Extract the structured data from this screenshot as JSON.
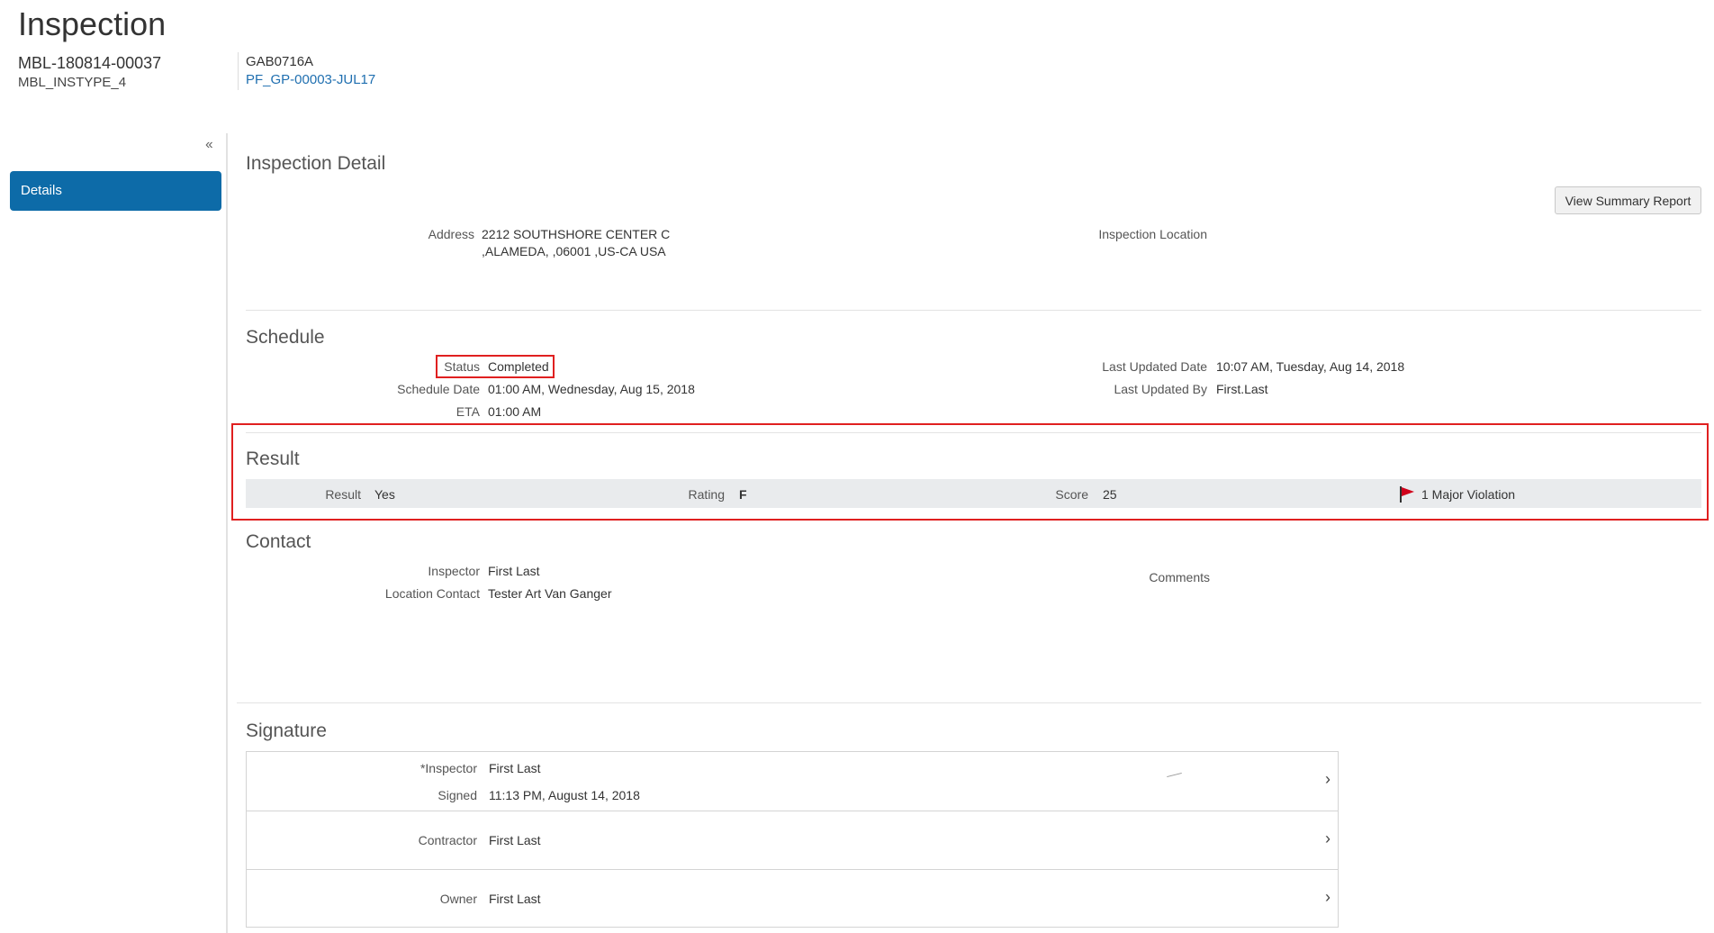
{
  "header": {
    "title": "Inspection",
    "record_id": "MBL-180814-00037",
    "record_type": "MBL_INSTYPE_4",
    "permit_code": "GAB0716A",
    "permit_link": "PF_GP-00003-JUL17"
  },
  "nav": {
    "collapse_glyph": "‹‹",
    "items": [
      {
        "label": "Details",
        "active": true
      }
    ]
  },
  "detail": {
    "title": "Inspection Detail",
    "summary_button": "View Summary Report",
    "address_label": "Address",
    "address_line1": "2212 SOUTHSHORE CENTER C",
    "address_line2": ",ALAMEDA, ,06001 ,US-CA USA",
    "location_label": "Inspection Location"
  },
  "schedule": {
    "title": "Schedule",
    "status_label": "Status",
    "status_value": "Completed",
    "schedule_date_label": "Schedule Date",
    "schedule_date_value": "01:00 AM, Wednesday, Aug 15, 2018",
    "eta_label": "ETA",
    "eta_value": "01:00 AM",
    "last_updated_date_label": "Last Updated Date",
    "last_updated_date_value": "10:07 AM, Tuesday, Aug 14, 2018",
    "last_updated_by_label": "Last Updated By",
    "last_updated_by_value": "First.Last"
  },
  "result": {
    "title": "Result",
    "result_label": "Result",
    "result_value": "Yes",
    "rating_label": "Rating",
    "rating_value": "F",
    "score_label": "Score",
    "score_value": "25",
    "violation_text": "1 Major Violation",
    "flag_color": "#d0021b"
  },
  "contact": {
    "title": "Contact",
    "inspector_label": "Inspector",
    "inspector_value": "First Last",
    "location_contact_label": "Location Contact",
    "location_contact_value": "Tester Art Van Ganger",
    "comments_label": "Comments"
  },
  "signature": {
    "title": "Signature",
    "chevron": "›",
    "rows": [
      {
        "label": "*Inspector",
        "value": "First Last",
        "signed_label": "Signed",
        "signed_value": "11:13 PM, August 14, 2018"
      },
      {
        "label": "Contractor",
        "value": "First Last"
      },
      {
        "label": "Owner",
        "value": "First Last"
      }
    ]
  },
  "colors": {
    "nav_active_bg": "#0d6ba8",
    "link": "#1f6fb0",
    "highlight_border": "#e02020",
    "result_band": "#e9ebed"
  }
}
